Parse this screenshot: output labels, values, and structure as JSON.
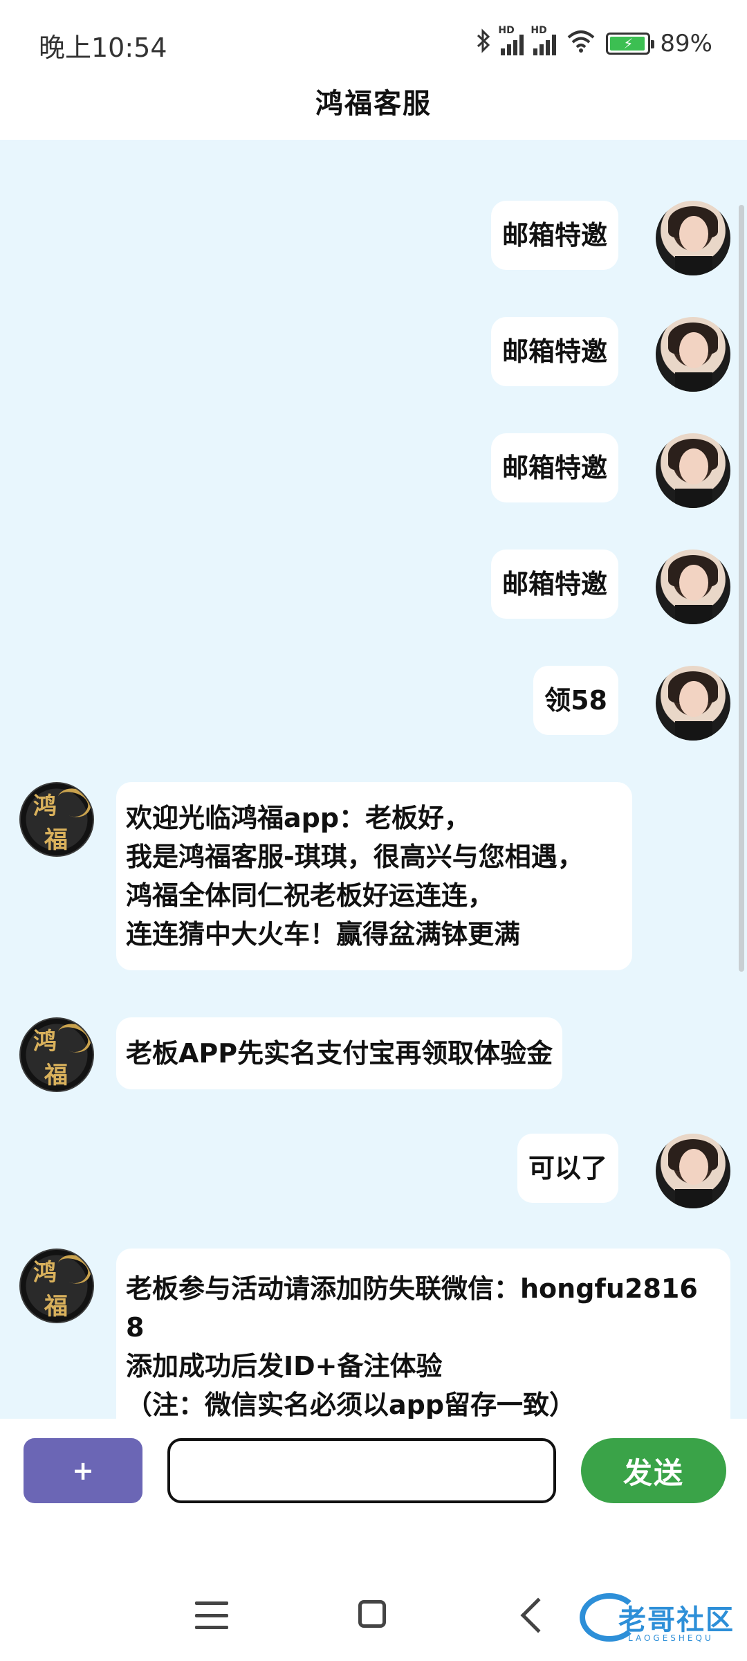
{
  "status_bar": {
    "time": "晚上10:54",
    "battery_percent": "89%",
    "signal_label": "HD"
  },
  "header": {
    "title": "鸿福客服"
  },
  "messages": [
    {
      "side": "right",
      "text": "邮箱特邀"
    },
    {
      "side": "right",
      "text": "邮箱特邀"
    },
    {
      "side": "right",
      "text": "邮箱特邀"
    },
    {
      "side": "right",
      "text": "邮箱特邀"
    },
    {
      "side": "right",
      "text": "领58"
    },
    {
      "side": "left",
      "text": "欢迎光临鸿福app：老板好，\n我是鸿福客服-琪琪，很高兴与您相遇，\n鸿福全体同仁祝老板好运连连，\n连连猜中大火车！赢得盆满钵更满"
    },
    {
      "side": "left",
      "text": "老板APP先实名支付宝再领取体验金"
    },
    {
      "side": "right",
      "text": "可以了"
    },
    {
      "side": "left",
      "text": "老板参与活动请添加防失联微信：hongfu2816\n8\n添加成功后发ID+备注体验\n（注：微信实名必须以app留存一致）"
    }
  ],
  "bot_avatar": {
    "glyph_top": "鸿",
    "glyph_bottom": "福"
  },
  "input_bar": {
    "plus_label": "+",
    "input_value": "",
    "send_label": "发送"
  },
  "watermark": {
    "text": "老哥社区",
    "subtext": "LAOGESHEQU"
  },
  "icons": [
    "bluetooth-icon",
    "signal-icon",
    "wifi-icon",
    "battery-icon",
    "menu-icon",
    "home-icon",
    "back-icon"
  ]
}
